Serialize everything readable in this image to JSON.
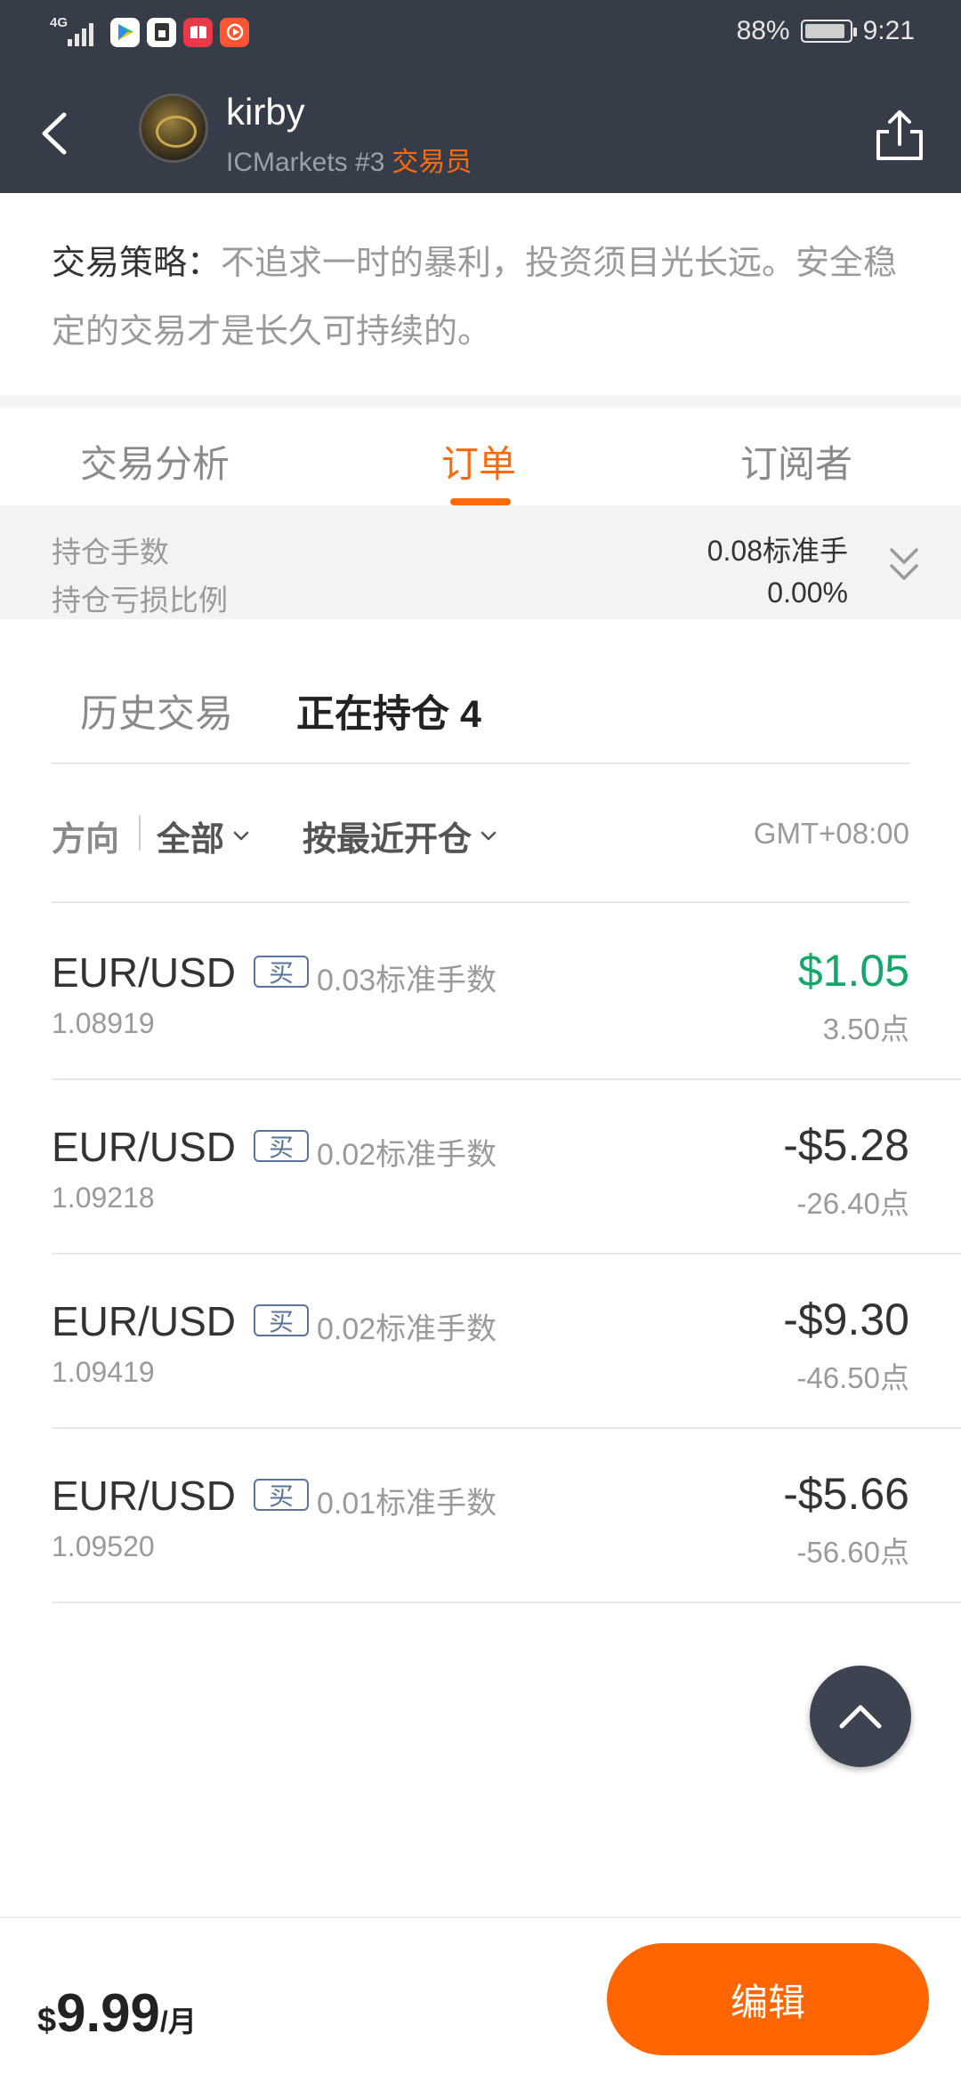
{
  "status_bar": {
    "network": "4G",
    "battery_percent": "88%",
    "battery_level": 0.88,
    "time": "9:21",
    "app_icons": [
      "play-store-icon",
      "sim-icon",
      "book-icon",
      "video-icon"
    ]
  },
  "header": {
    "username": "kirby",
    "broker_rank": "ICMarkets #3",
    "role": "交易员",
    "back_icon": "chevron-left-icon",
    "share_icon": "share-icon",
    "bg_color": "#363d48"
  },
  "strategy": {
    "label": "交易策略：",
    "text": "不追求一时的暴利，投资须目光长远。安全稳定的交易才是长久可持续的。"
  },
  "tabs": [
    {
      "label": "交易分析",
      "active": false
    },
    {
      "label": "订单",
      "active": true
    },
    {
      "label": "订阅者",
      "active": false
    }
  ],
  "summary": {
    "lots_label": "持仓手数",
    "lots_value": "0.08标准手",
    "pl_ratio_label": "持仓亏损比例",
    "pl_ratio_value": "0.00%"
  },
  "subtabs": [
    {
      "label": "历史交易",
      "active": false
    },
    {
      "label": "正在持仓 4",
      "active": true
    }
  ],
  "filters": {
    "direction_label": "方向",
    "direction_value": "全部",
    "sort_value": "按最近开仓",
    "timezone": "GMT+08:00"
  },
  "positions": [
    {
      "pair": "EUR/USD",
      "side": "买",
      "lots": "0.03标准手数",
      "open_price": "1.08919",
      "pl": "$1.05",
      "points": "3.50点",
      "profit": true
    },
    {
      "pair": "EUR/USD",
      "side": "买",
      "lots": "0.02标准手数",
      "open_price": "1.09218",
      "pl": "-$5.28",
      "points": "-26.40点",
      "profit": false
    },
    {
      "pair": "EUR/USD",
      "side": "买",
      "lots": "0.02标准手数",
      "open_price": "1.09419",
      "pl": "-$9.30",
      "points": "-46.50点",
      "profit": false
    },
    {
      "pair": "EUR/USD",
      "side": "买",
      "lots": "0.01标准手数",
      "open_price": "1.09520",
      "pl": "-$5.66",
      "points": "-56.60点",
      "profit": false
    }
  ],
  "footer": {
    "currency": "$",
    "price": "9.99",
    "period": "/月",
    "edit_label": "编辑",
    "accent_color": "#ff6500"
  },
  "colors": {
    "accent": "#ff6a0d",
    "profit": "#14a66a",
    "tag_border": "#5b7499"
  }
}
